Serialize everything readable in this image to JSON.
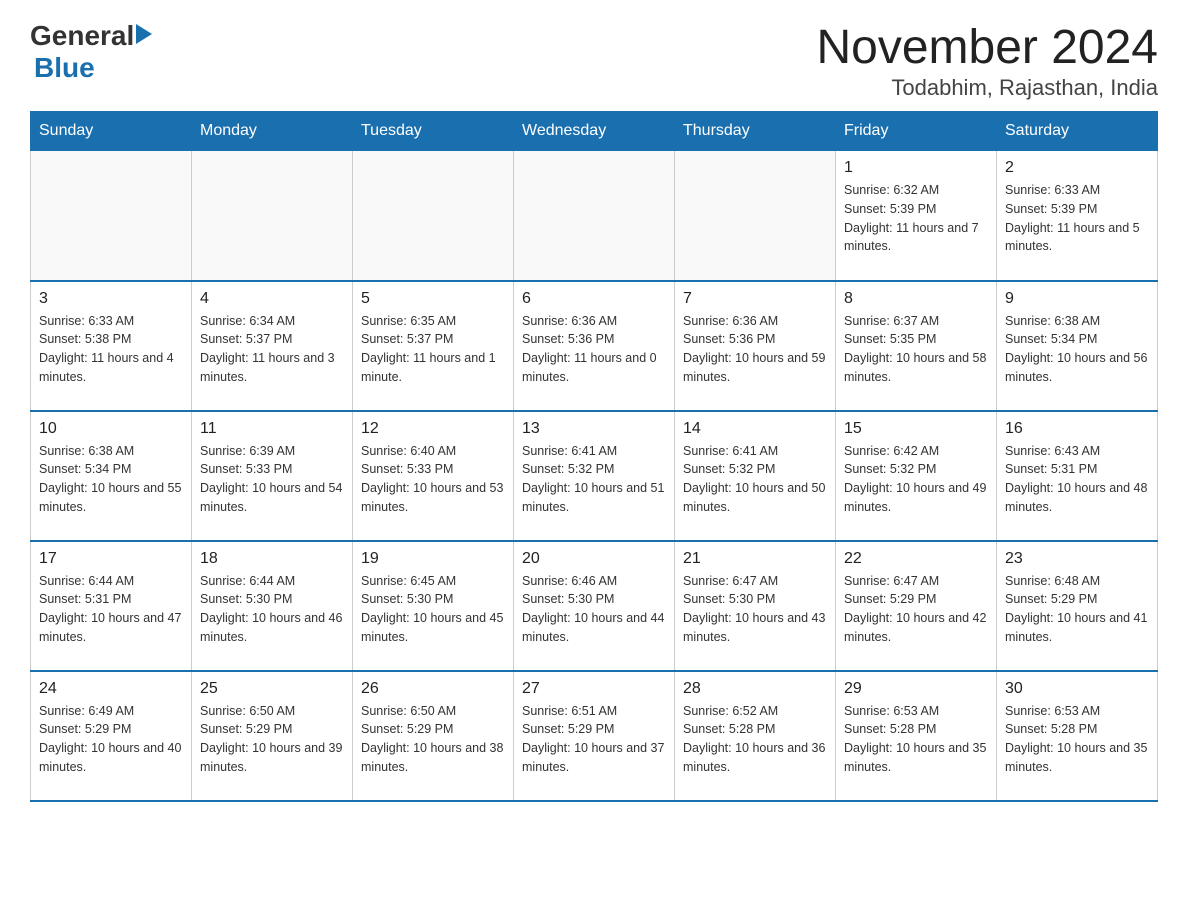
{
  "header": {
    "logo": {
      "text_general": "General",
      "text_blue": "Blue"
    },
    "month_year": "November 2024",
    "location": "Todabhim, Rajasthan, India"
  },
  "weekdays": [
    "Sunday",
    "Monday",
    "Tuesday",
    "Wednesday",
    "Thursday",
    "Friday",
    "Saturday"
  ],
  "rows": [
    [
      {
        "day": "",
        "sunrise": "",
        "sunset": "",
        "daylight": ""
      },
      {
        "day": "",
        "sunrise": "",
        "sunset": "",
        "daylight": ""
      },
      {
        "day": "",
        "sunrise": "",
        "sunset": "",
        "daylight": ""
      },
      {
        "day": "",
        "sunrise": "",
        "sunset": "",
        "daylight": ""
      },
      {
        "day": "",
        "sunrise": "",
        "sunset": "",
        "daylight": ""
      },
      {
        "day": "1",
        "sunrise": "Sunrise: 6:32 AM",
        "sunset": "Sunset: 5:39 PM",
        "daylight": "Daylight: 11 hours and 7 minutes."
      },
      {
        "day": "2",
        "sunrise": "Sunrise: 6:33 AM",
        "sunset": "Sunset: 5:39 PM",
        "daylight": "Daylight: 11 hours and 5 minutes."
      }
    ],
    [
      {
        "day": "3",
        "sunrise": "Sunrise: 6:33 AM",
        "sunset": "Sunset: 5:38 PM",
        "daylight": "Daylight: 11 hours and 4 minutes."
      },
      {
        "day": "4",
        "sunrise": "Sunrise: 6:34 AM",
        "sunset": "Sunset: 5:37 PM",
        "daylight": "Daylight: 11 hours and 3 minutes."
      },
      {
        "day": "5",
        "sunrise": "Sunrise: 6:35 AM",
        "sunset": "Sunset: 5:37 PM",
        "daylight": "Daylight: 11 hours and 1 minute."
      },
      {
        "day": "6",
        "sunrise": "Sunrise: 6:36 AM",
        "sunset": "Sunset: 5:36 PM",
        "daylight": "Daylight: 11 hours and 0 minutes."
      },
      {
        "day": "7",
        "sunrise": "Sunrise: 6:36 AM",
        "sunset": "Sunset: 5:36 PM",
        "daylight": "Daylight: 10 hours and 59 minutes."
      },
      {
        "day": "8",
        "sunrise": "Sunrise: 6:37 AM",
        "sunset": "Sunset: 5:35 PM",
        "daylight": "Daylight: 10 hours and 58 minutes."
      },
      {
        "day": "9",
        "sunrise": "Sunrise: 6:38 AM",
        "sunset": "Sunset: 5:34 PM",
        "daylight": "Daylight: 10 hours and 56 minutes."
      }
    ],
    [
      {
        "day": "10",
        "sunrise": "Sunrise: 6:38 AM",
        "sunset": "Sunset: 5:34 PM",
        "daylight": "Daylight: 10 hours and 55 minutes."
      },
      {
        "day": "11",
        "sunrise": "Sunrise: 6:39 AM",
        "sunset": "Sunset: 5:33 PM",
        "daylight": "Daylight: 10 hours and 54 minutes."
      },
      {
        "day": "12",
        "sunrise": "Sunrise: 6:40 AM",
        "sunset": "Sunset: 5:33 PM",
        "daylight": "Daylight: 10 hours and 53 minutes."
      },
      {
        "day": "13",
        "sunrise": "Sunrise: 6:41 AM",
        "sunset": "Sunset: 5:32 PM",
        "daylight": "Daylight: 10 hours and 51 minutes."
      },
      {
        "day": "14",
        "sunrise": "Sunrise: 6:41 AM",
        "sunset": "Sunset: 5:32 PM",
        "daylight": "Daylight: 10 hours and 50 minutes."
      },
      {
        "day": "15",
        "sunrise": "Sunrise: 6:42 AM",
        "sunset": "Sunset: 5:32 PM",
        "daylight": "Daylight: 10 hours and 49 minutes."
      },
      {
        "day": "16",
        "sunrise": "Sunrise: 6:43 AM",
        "sunset": "Sunset: 5:31 PM",
        "daylight": "Daylight: 10 hours and 48 minutes."
      }
    ],
    [
      {
        "day": "17",
        "sunrise": "Sunrise: 6:44 AM",
        "sunset": "Sunset: 5:31 PM",
        "daylight": "Daylight: 10 hours and 47 minutes."
      },
      {
        "day": "18",
        "sunrise": "Sunrise: 6:44 AM",
        "sunset": "Sunset: 5:30 PM",
        "daylight": "Daylight: 10 hours and 46 minutes."
      },
      {
        "day": "19",
        "sunrise": "Sunrise: 6:45 AM",
        "sunset": "Sunset: 5:30 PM",
        "daylight": "Daylight: 10 hours and 45 minutes."
      },
      {
        "day": "20",
        "sunrise": "Sunrise: 6:46 AM",
        "sunset": "Sunset: 5:30 PM",
        "daylight": "Daylight: 10 hours and 44 minutes."
      },
      {
        "day": "21",
        "sunrise": "Sunrise: 6:47 AM",
        "sunset": "Sunset: 5:30 PM",
        "daylight": "Daylight: 10 hours and 43 minutes."
      },
      {
        "day": "22",
        "sunrise": "Sunrise: 6:47 AM",
        "sunset": "Sunset: 5:29 PM",
        "daylight": "Daylight: 10 hours and 42 minutes."
      },
      {
        "day": "23",
        "sunrise": "Sunrise: 6:48 AM",
        "sunset": "Sunset: 5:29 PM",
        "daylight": "Daylight: 10 hours and 41 minutes."
      }
    ],
    [
      {
        "day": "24",
        "sunrise": "Sunrise: 6:49 AM",
        "sunset": "Sunset: 5:29 PM",
        "daylight": "Daylight: 10 hours and 40 minutes."
      },
      {
        "day": "25",
        "sunrise": "Sunrise: 6:50 AM",
        "sunset": "Sunset: 5:29 PM",
        "daylight": "Daylight: 10 hours and 39 minutes."
      },
      {
        "day": "26",
        "sunrise": "Sunrise: 6:50 AM",
        "sunset": "Sunset: 5:29 PM",
        "daylight": "Daylight: 10 hours and 38 minutes."
      },
      {
        "day": "27",
        "sunrise": "Sunrise: 6:51 AM",
        "sunset": "Sunset: 5:29 PM",
        "daylight": "Daylight: 10 hours and 37 minutes."
      },
      {
        "day": "28",
        "sunrise": "Sunrise: 6:52 AM",
        "sunset": "Sunset: 5:28 PM",
        "daylight": "Daylight: 10 hours and 36 minutes."
      },
      {
        "day": "29",
        "sunrise": "Sunrise: 6:53 AM",
        "sunset": "Sunset: 5:28 PM",
        "daylight": "Daylight: 10 hours and 35 minutes."
      },
      {
        "day": "30",
        "sunrise": "Sunrise: 6:53 AM",
        "sunset": "Sunset: 5:28 PM",
        "daylight": "Daylight: 10 hours and 35 minutes."
      }
    ]
  ]
}
